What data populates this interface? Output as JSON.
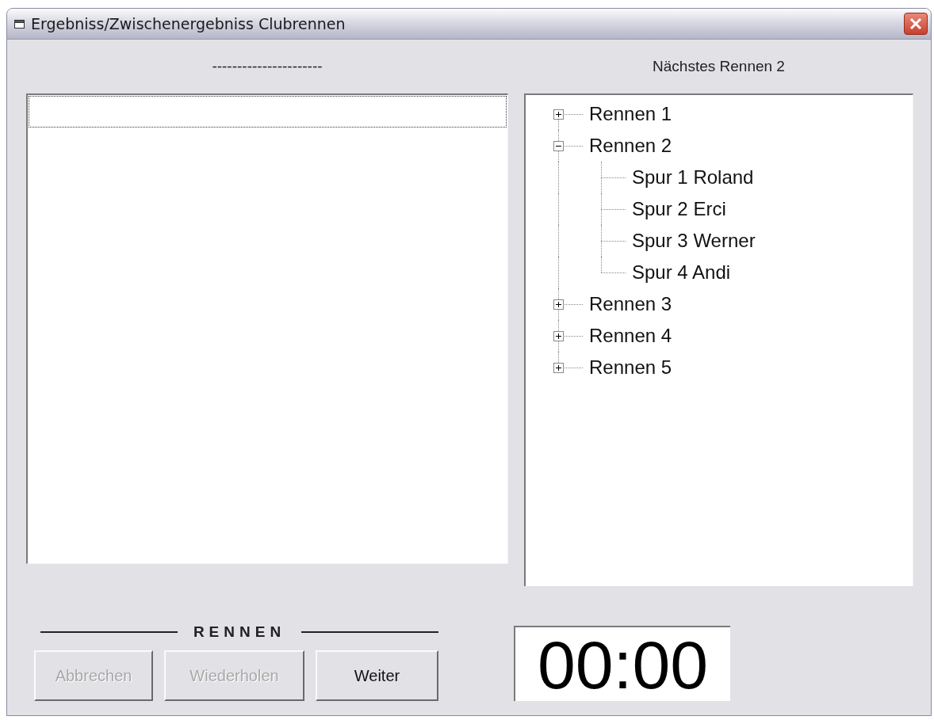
{
  "window": {
    "title": "Ergebniss/Zwischenergebniss Clubrennen"
  },
  "left_header": "----------------------",
  "right_header": "Nächstes Rennen 2",
  "tree": [
    {
      "label": "Rennen 1",
      "expanded": false
    },
    {
      "label": "Rennen 2",
      "expanded": true,
      "children": [
        {
          "label": "Spur 1 Roland"
        },
        {
          "label": "Spur 2 Erci"
        },
        {
          "label": "Spur 3 Werner"
        },
        {
          "label": "Spur 4 Andi"
        }
      ]
    },
    {
      "label": "Rennen 3",
      "expanded": false
    },
    {
      "label": "Rennen 4",
      "expanded": false
    },
    {
      "label": "Rennen 5",
      "expanded": false
    }
  ],
  "group_label": "RENNEN",
  "buttons": [
    {
      "label": "Abbrechen",
      "disabled": true
    },
    {
      "label": "Wiederholen",
      "disabled": true
    },
    {
      "label": "Weiter",
      "disabled": false
    }
  ],
  "timer": "00:00"
}
